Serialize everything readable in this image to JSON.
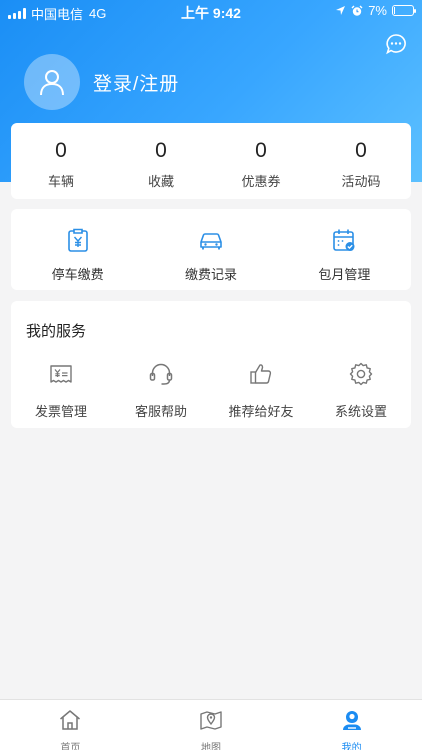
{
  "status_bar": {
    "carrier": "中国电信",
    "network": "4G",
    "time": "上午 9:42",
    "battery": "7%",
    "battery_level": 0.07
  },
  "header": {
    "login_label": "登录/注册",
    "message_icon": "chat-bubble-icon",
    "avatar_icon": "user-avatar-icon"
  },
  "stats": [
    {
      "value": "0",
      "label": "车辆"
    },
    {
      "value": "0",
      "label": "收藏"
    },
    {
      "value": "0",
      "label": "优惠券"
    },
    {
      "value": "0",
      "label": "活动码"
    }
  ],
  "quick_actions": [
    {
      "label": "停车缴费",
      "icon": "parking-payment-icon"
    },
    {
      "label": "缴费记录",
      "icon": "car-icon"
    },
    {
      "label": "包月管理",
      "icon": "calendar-check-icon"
    }
  ],
  "services": {
    "title": "我的服务",
    "items": [
      {
        "label": "发票管理",
        "icon": "invoice-icon"
      },
      {
        "label": "客服帮助",
        "icon": "headset-icon"
      },
      {
        "label": "推荐给好友",
        "icon": "thumbs-up-icon"
      },
      {
        "label": "系统设置",
        "icon": "gear-icon"
      }
    ]
  },
  "tabbar": [
    {
      "label": "首页",
      "icon": "home-icon",
      "active": false
    },
    {
      "label": "地图",
      "icon": "map-icon",
      "active": false
    },
    {
      "label": "我的",
      "icon": "profile-icon",
      "active": true
    }
  ],
  "colors": {
    "accent": "#1b8cf2",
    "header_gradient_start": "#1a8ef5",
    "header_gradient_end": "#5cc0ff",
    "icon_blue": "#2b8fe6",
    "icon_gray": "#777777"
  }
}
